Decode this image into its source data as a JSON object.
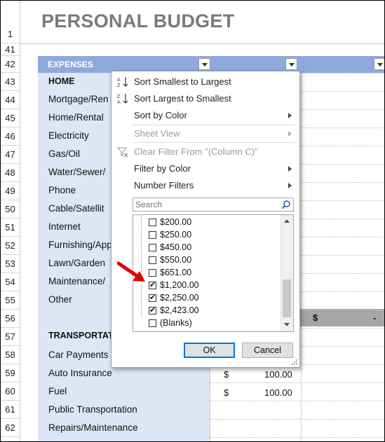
{
  "title": "PERSONAL BUDGET",
  "row_numbers": [
    "1",
    "41",
    "42",
    "43",
    "44",
    "45",
    "46",
    "47",
    "48",
    "49",
    "50",
    "51",
    "52",
    "53",
    "54",
    "55",
    "56",
    "57",
    "58",
    "59",
    "60",
    "61",
    "62"
  ],
  "expenses_header": "EXPENSES",
  "categories": {
    "home": "HOME",
    "home_items": [
      "Mortgage/Ren",
      "Home/Rental",
      "Electricity",
      "Gas/Oil",
      "Water/Sewer/",
      "Phone",
      "Cable/Satellit",
      "Internet",
      "Furnishing/App",
      "Lawn/Garden",
      "Maintenance/",
      "Other"
    ],
    "transport": "TRANSPORTAT",
    "transport_items": [
      "Car Payments",
      "Auto Insurance",
      "Fuel",
      "Public Transportation",
      "Repairs/Maintenance"
    ]
  },
  "totals": {
    "currency": "$",
    "value": "-"
  },
  "amounts": [
    {
      "currency": "$",
      "value": "100.00"
    },
    {
      "currency": "$",
      "value": "100.00"
    }
  ],
  "filter_menu": {
    "sort_asc": "Sort Smallest to Largest",
    "sort_desc": "Sort Largest to Smallest",
    "sort_color": "Sort by Color",
    "sheet_view": "Sheet View",
    "clear_filter": "Clear Filter From \"(Column C)\"",
    "filter_color": "Filter by Color",
    "number_filters": "Number Filters",
    "search_placeholder": "Search",
    "values": [
      {
        "label": "$200.00",
        "checked": false
      },
      {
        "label": "$250.00",
        "checked": false
      },
      {
        "label": "$450.00",
        "checked": false
      },
      {
        "label": "$550.00",
        "checked": false
      },
      {
        "label": "$651.00",
        "checked": false
      },
      {
        "label": "$1,200.00",
        "checked": true
      },
      {
        "label": "$2,250.00",
        "checked": true
      },
      {
        "label": "$2,423.00",
        "checked": true
      },
      {
        "label": "(Blanks)",
        "checked": false
      }
    ],
    "ok": "OK",
    "cancel": "Cancel"
  },
  "colors": {
    "header_blue": "#8ea9db",
    "label_fill": "#dde6f4",
    "total_fill": "#a6a6a6",
    "arrow_red": "#e00000"
  }
}
